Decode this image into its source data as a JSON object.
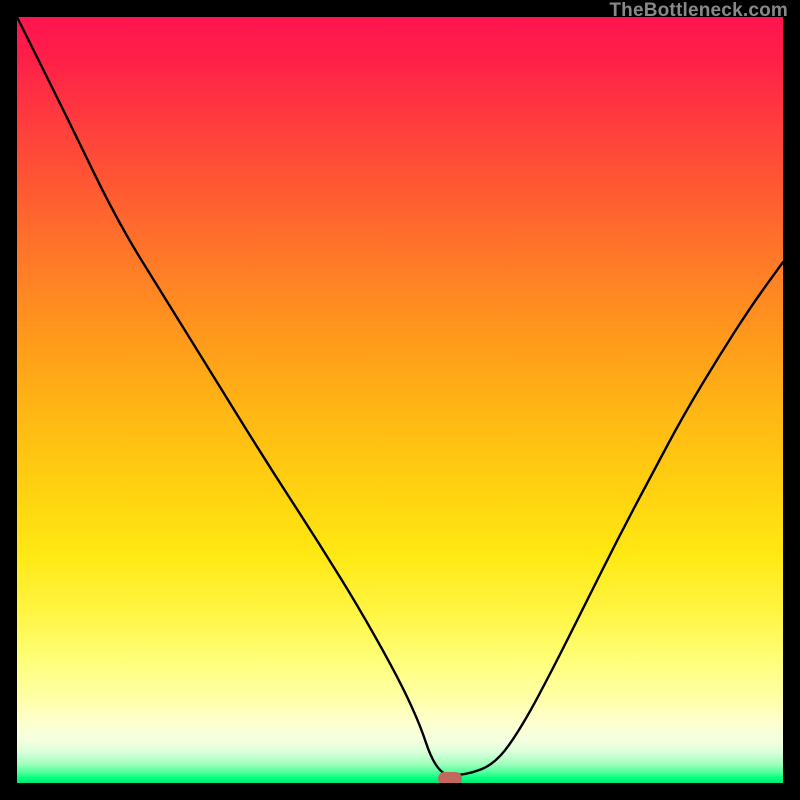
{
  "watermark": "TheBottleneck.com",
  "marker": {
    "x": 0.565,
    "width_frac": 0.032,
    "height_frac": 0.018
  },
  "chart_data": {
    "type": "line",
    "title": "",
    "xlabel": "",
    "ylabel": "",
    "xlim": [
      0,
      1
    ],
    "ylim": [
      0,
      1
    ],
    "series": [
      {
        "name": "bottleneck-curve",
        "x": [
          0.0,
          0.065,
          0.13,
          0.195,
          0.26,
          0.325,
          0.39,
          0.455,
          0.52,
          0.548,
          0.585,
          0.625,
          0.66,
          0.7,
          0.74,
          0.785,
          0.83,
          0.87,
          0.915,
          0.96,
          1.0
        ],
        "y": [
          1.0,
          0.87,
          0.735,
          0.63,
          0.525,
          0.42,
          0.32,
          0.215,
          0.095,
          0.01,
          0.01,
          0.025,
          0.075,
          0.15,
          0.23,
          0.32,
          0.405,
          0.48,
          0.555,
          0.625,
          0.68
        ]
      }
    ],
    "marker_point": {
      "x": 0.565,
      "y": 0.006
    },
    "background_gradient": {
      "top": "#ff1450",
      "mid": "#ffe812",
      "bottom": "#00e573"
    }
  }
}
